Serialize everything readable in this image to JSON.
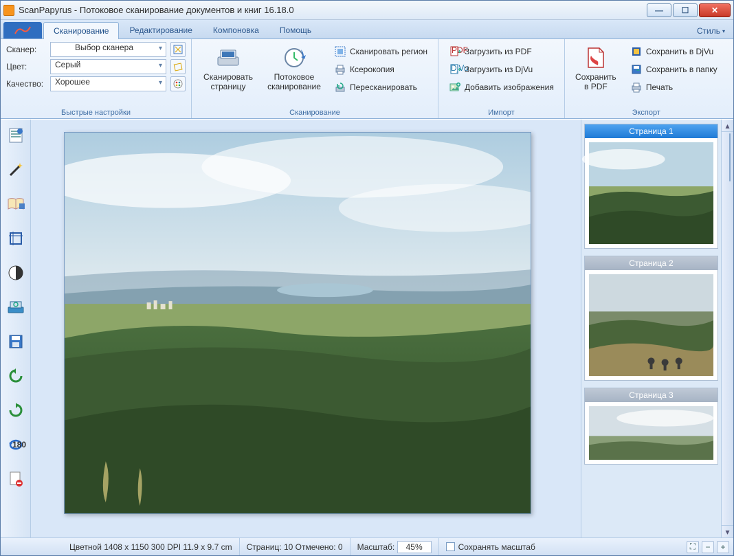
{
  "window": {
    "title": "ScanPapyrus - Потоковое сканирование документов и книг 16.18.0"
  },
  "tabs": {
    "scan": "Сканирование",
    "edit": "Редактирование",
    "layout": "Компоновка",
    "help": "Помощь",
    "style": "Стиль"
  },
  "quick": {
    "scanner_label": "Сканер:",
    "scanner_value": "Выбор сканера",
    "color_label": "Цвет:",
    "color_value": "Серый",
    "quality_label": "Качество:",
    "quality_value": "Хорошее",
    "group_title": "Быстрые настройки"
  },
  "scan_group": {
    "scan_page": "Сканировать\nстраницу",
    "batch_scan": "Потоковое\nсканирование",
    "scan_region": "Сканировать регион",
    "xerox": "Ксерокопия",
    "rescan": "Пересканировать",
    "group_title": "Сканирование"
  },
  "import_group": {
    "load_pdf": "Загрузить из PDF",
    "load_djvu": "Загрузить из DjVu",
    "add_images": "Добавить изображения",
    "group_title": "Импорт"
  },
  "export_group": {
    "save_pdf": "Сохранить\nв PDF",
    "save_djvu": "Сохранить в DjVu",
    "save_folder": "Сохранить в папку",
    "print": "Печать",
    "group_title": "Экспорт"
  },
  "thumbs": {
    "p1": "Страница 1",
    "p2": "Страница 2",
    "p3": "Страница 3"
  },
  "status": {
    "info": "Цветной  1408 x 1150  300 DPI  11.9 x 9.7 cm",
    "pages": "Страниц: 10 Отмечено: 0",
    "zoom_label": "Масштаб:",
    "zoom_value": "45%",
    "keep_zoom": "Сохранять масштаб"
  }
}
